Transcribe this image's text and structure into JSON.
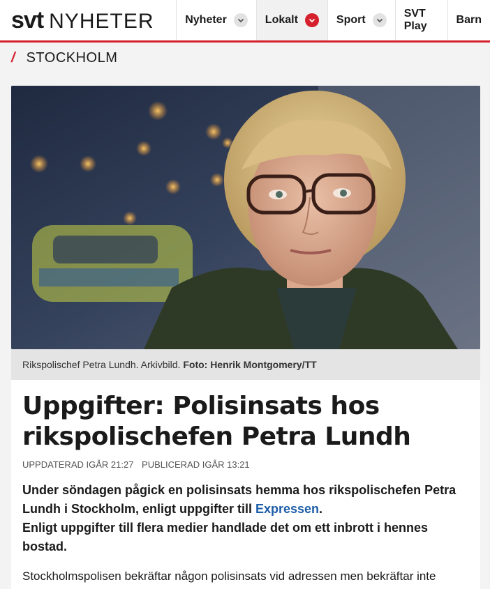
{
  "header": {
    "brand_svt": "svt",
    "brand_section": "NYHETER",
    "nav": [
      {
        "label": "Nyheter",
        "active": false
      },
      {
        "label": "Lokalt",
        "active": true
      },
      {
        "label": "Sport",
        "active": false
      },
      {
        "label": "SVT Play"
      },
      {
        "label": "Barn"
      }
    ]
  },
  "section": {
    "slash": "/",
    "title": "STOCKHOLM"
  },
  "image": {
    "caption": "Rikspolischef Petra Lundh. Arkivbild.",
    "credit": "Foto: Henrik Montgomery/TT"
  },
  "article": {
    "title": "Uppgifter: Polisinsats hos rikspolischefen Petra Lundh",
    "updated": "UPPDATERAD IGÅR 21:27",
    "published": "PUBLICERAD IGÅR 13:21",
    "lead_part1": "Under söndagen pågick en polisinsats hemma hos rikspolischefen Petra Lundh i Stockholm, enligt uppgifter till ",
    "lead_link": "Expressen",
    "lead_part2": ".",
    "lead_second": "Enligt uppgifter till flera medier handlade det om ett inbrott i hennes bostad.",
    "body_start": "Stockholmspolisen bekräftar någon polisinsats vid adressen men bekräftar inte"
  },
  "colors": {
    "accent": "#d5202d",
    "link": "#1e5ea8"
  }
}
